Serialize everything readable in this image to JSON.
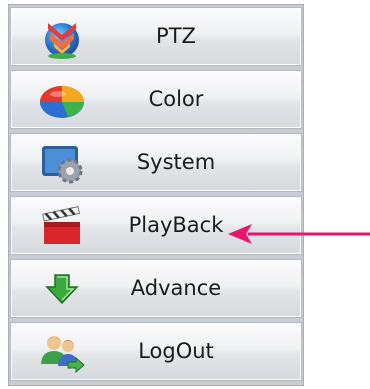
{
  "menu": {
    "items": [
      {
        "label": "PTZ",
        "icon": "ptz-icon"
      },
      {
        "label": "Color",
        "icon": "color-icon"
      },
      {
        "label": "System",
        "icon": "system-icon"
      },
      {
        "label": "PlayBack",
        "icon": "clapperboard-icon"
      },
      {
        "label": "Advance",
        "icon": "down-arrow-icon"
      },
      {
        "label": "LogOut",
        "icon": "users-icon"
      }
    ]
  },
  "annotation": {
    "arrow_color": "#e8156b",
    "points_to": "PlayBack"
  }
}
